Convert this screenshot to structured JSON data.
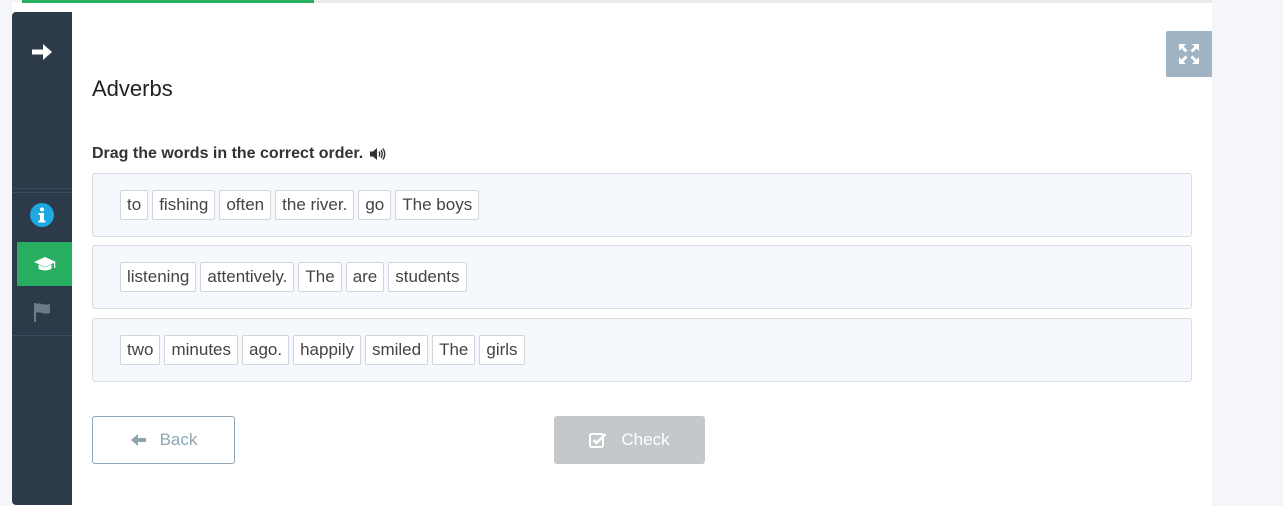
{
  "progress": {
    "fraction": 0.245
  },
  "colors": {
    "sidebar": "#2d3a4a",
    "accent_green": "#27ae60",
    "info_blue": "#1ea7e1",
    "fullscreen": "#9fb3c2",
    "row_bg": "#f5f9fd"
  },
  "sidebar": {
    "items": [
      {
        "icon": "arrow-right-icon"
      },
      {
        "icon": "info-circle-icon"
      },
      {
        "icon": "graduation-cap-icon",
        "active": true
      },
      {
        "icon": "flag-icon"
      }
    ]
  },
  "fullscreen": {
    "icon": "expand-icon"
  },
  "exercise": {
    "title": "Adverbs",
    "instruction": "Drag the words in the correct order.",
    "audio_icon": "speaker-icon",
    "rows": [
      {
        "words": [
          "to",
          "fishing",
          "often",
          "the river.",
          "go",
          "The boys"
        ]
      },
      {
        "words": [
          "listening",
          "attentively.",
          "The",
          "are",
          "students"
        ]
      },
      {
        "words": [
          "two",
          "minutes",
          "ago.",
          "happily",
          "smiled",
          "The",
          "girls"
        ]
      }
    ]
  },
  "buttons": {
    "back_label": "Back",
    "back_icon": "arrow-left-icon",
    "check_label": "Check",
    "check_icon": "check-square-icon"
  }
}
